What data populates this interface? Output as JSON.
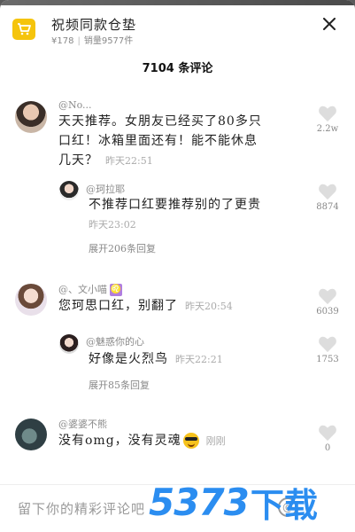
{
  "product": {
    "title": "祝频同款仓垫",
    "price": "¥178",
    "sales": "销量9577件",
    "cart_icon": "cart-icon",
    "close_icon": "close-icon"
  },
  "comments_header": "7104 条评论",
  "comments": [
    {
      "username": "@No...",
      "text_lines": [
        "天天推荐。女朋友已经买了80多只",
        "口红！冰箱里面还有！能不能休息",
        "几天？"
      ],
      "time": "昨天22:51",
      "likes": "2.2w"
    },
    {
      "username": "@珂拉耶",
      "text_lines": [
        "不推荐口红要推荐别的了更贵"
      ],
      "time": "昨天23:02",
      "likes": "8874",
      "expand": "展开206条回复"
    },
    {
      "username": "@、文小喵",
      "badge": "♌",
      "text_lines": [
        "您珂思口红，别翻了"
      ],
      "time": "昨天20:54",
      "likes": "6039"
    },
    {
      "username": "@魅惑你的心",
      "text_lines": [
        "好像是火烈鸟"
      ],
      "time": "昨天22:21",
      "likes": "1753",
      "expand": "展开85条回复"
    },
    {
      "username": "@婆婆不熊",
      "text_lines": [
        "没有omg，没有灵魂"
      ],
      "time": "刚刚",
      "likes": "0"
    }
  ],
  "input": {
    "placeholder": "留下你的精彩评论吧",
    "at_symbol": "@"
  },
  "watermark": {
    "num": "5373",
    "cn": "下载"
  },
  "colors": {
    "accent": "#f5c40c",
    "watermark": "#2b8df0",
    "muted": "#888888"
  }
}
